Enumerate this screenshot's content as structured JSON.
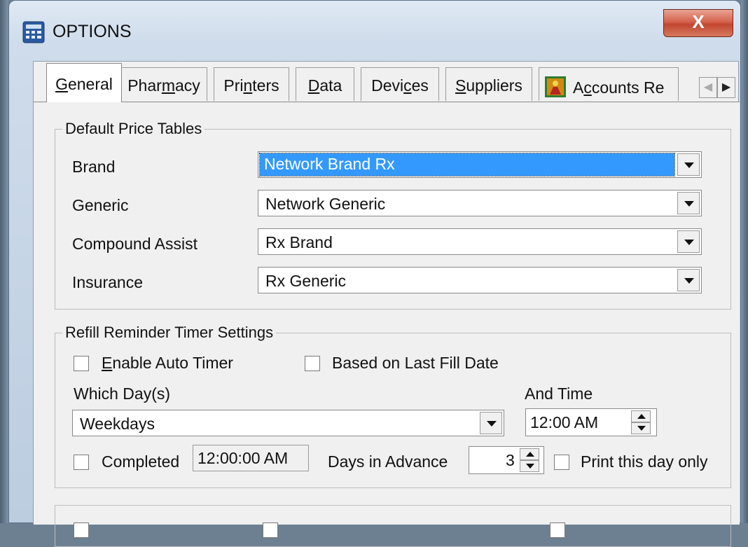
{
  "window": {
    "title": "OPTIONS",
    "close_label": "X"
  },
  "tabs": [
    {
      "label": "General",
      "mnemonic": "G",
      "rest": "eneral"
    },
    {
      "label": "Pharmacy",
      "pre": "Phar",
      "mnemonic": "m",
      "rest": "acy"
    },
    {
      "label": "Printers",
      "pre": "Pri",
      "mnemonic": "n",
      "rest": "ters"
    },
    {
      "label": "Data",
      "mnemonic": "D",
      "rest": "ata"
    },
    {
      "label": "Devices",
      "pre": "Devi",
      "mnemonic": "c",
      "rest": "es"
    },
    {
      "label": "Suppliers",
      "mnemonic": "S",
      "rest": "uppliers"
    },
    {
      "label": "Accounts Re",
      "pre": "A",
      "mnemonic": "c",
      "rest": "counts Re"
    }
  ],
  "default_price_tables": {
    "legend": "Default Price Tables",
    "rows": [
      {
        "label": "Brand",
        "value": "Network Brand Rx"
      },
      {
        "label": "Generic",
        "value": "Network Generic"
      },
      {
        "label": "Compound Assist",
        "value": "Rx Brand"
      },
      {
        "label": "Insurance",
        "value": "Rx Generic"
      }
    ]
  },
  "refill": {
    "legend": "Refill Reminder Timer Settings",
    "enable_auto_timer": {
      "mnemonic": "E",
      "rest": "nable Auto Timer"
    },
    "based_on_last_fill": "Based on Last Fill Date",
    "which_days_label": "Which Day(s)",
    "which_days_value": "Weekdays",
    "and_time_label": "And Time",
    "time_value": "12:00 AM",
    "completed_label": "Completed",
    "completed_time": "12:00:00 AM",
    "days_in_advance_label": "Days in Advance",
    "days_in_advance_value": "3",
    "print_this_day_only": "Print this day only"
  }
}
